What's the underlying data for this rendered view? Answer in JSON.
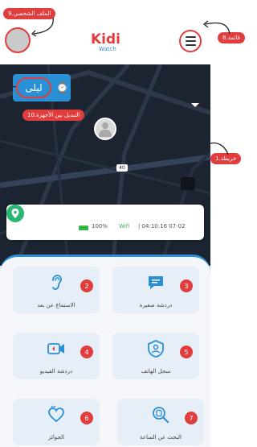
{
  "header": {
    "logo_text": "Kidi",
    "logo_sub": "Watch"
  },
  "device": {
    "name": "ليلى"
  },
  "status": {
    "battery": "100%",
    "network": "Wifi",
    "timestamp": "| 04:10:16 07-02"
  },
  "map": {
    "road_number": "40"
  },
  "tiles": [
    {
      "label": "الاستماع عن بعد",
      "num": "2"
    },
    {
      "label": "دردشة صغيرة",
      "num": "3"
    },
    {
      "label": "دردشة الفيديو",
      "num": "4"
    },
    {
      "label": "سجل الهاتف",
      "num": "5"
    },
    {
      "label": "الجوائز",
      "num": "6"
    },
    {
      "label": "البحث عن الساعة",
      "num": "7"
    }
  ],
  "annotations": {
    "profile": "9.الملف الشخصي",
    "menu": "8.قائمة",
    "switch": "10.التبديل بين الأجهزة",
    "map": "1.خريطة",
    "side3": "3",
    "side4": "4"
  },
  "colors": {
    "accent": "#2a90d6",
    "annotation": "#e23d3d",
    "map_bg": "#1d2431"
  }
}
